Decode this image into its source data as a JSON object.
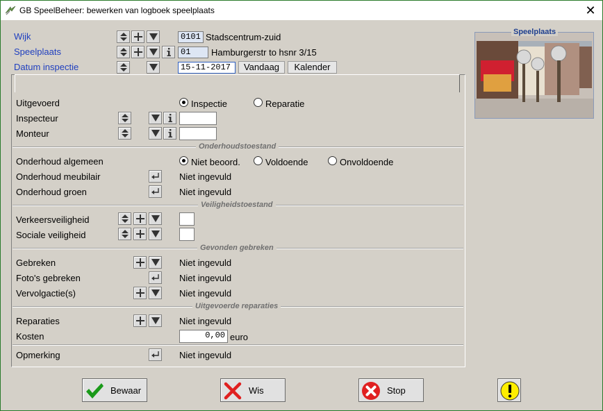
{
  "window": {
    "title": "GB SpeelBeheer: bewerken van logboek speelplaats",
    "close_glyph": "✕"
  },
  "header": {
    "wijk_label": "Wijk",
    "wijk_code": "0101",
    "wijk_name": "Stadscentrum-zuid",
    "speelplaats_label": "Speelplaats",
    "speelplaats_code": "01",
    "speelplaats_name": "Hamburgerstr to hsnr 3/15",
    "datum_label": "Datum inspectie",
    "datum_value": "15-11-2017",
    "vandaag_label": "Vandaag",
    "kalender_label": "Kalender"
  },
  "photo": {
    "caption": "Speelplaats"
  },
  "form": {
    "uitgevoerd_label": "Uitgevoerd",
    "uitgevoerd_options": [
      "Inspectie",
      "Reparatie"
    ],
    "uitgevoerd_selected": "Inspectie",
    "inspecteur_label": "Inspecteur",
    "monteur_label": "Monteur",
    "sections": {
      "onderhoud": "Onderhoudstoestand",
      "veiligheid": "Veiligheidstoestand",
      "gebreken": "Gevonden gebreken",
      "reparaties": "Uitgevoerde reparaties"
    },
    "onderhoud_algemeen_label": "Onderhoud algemeen",
    "onderhoud_options": [
      "Niet beoord.",
      "Voldoende",
      "Onvoldoende"
    ],
    "onderhoud_selected": "Niet beoord.",
    "onderhoud_meubilair_label": "Onderhoud meubilair",
    "onderhoud_meubilair_value": "Niet ingevuld",
    "onderhoud_groen_label": "Onderhoud groen",
    "onderhoud_groen_value": "Niet ingevuld",
    "verkeersveiligheid_label": "Verkeersveiligheid",
    "sociale_veiligheid_label": "Sociale veiligheid",
    "gebreken_label": "Gebreken",
    "gebreken_value": "Niet ingevuld",
    "fotos_label": "Foto's gebreken",
    "fotos_value": "Niet ingevuld",
    "vervolgactie_label": "Vervolgactie(s)",
    "vervolgactie_value": "Niet ingevuld",
    "reparaties_label": "Reparaties",
    "reparaties_value": "Niet ingevuld",
    "kosten_label": "Kosten",
    "kosten_value": "0,00",
    "kosten_unit": "euro",
    "opmerking_label": "Opmerking",
    "opmerking_value": "Niet ingevuld"
  },
  "buttons": {
    "bewaar": "Bewaar",
    "wis": "Wis",
    "stop": "Stop"
  },
  "colors": {
    "label_blue": "#1f3fbf",
    "check_green": "#1a9a1a",
    "stop_red": "#e02020",
    "warning_yellow": "#ffee00"
  }
}
